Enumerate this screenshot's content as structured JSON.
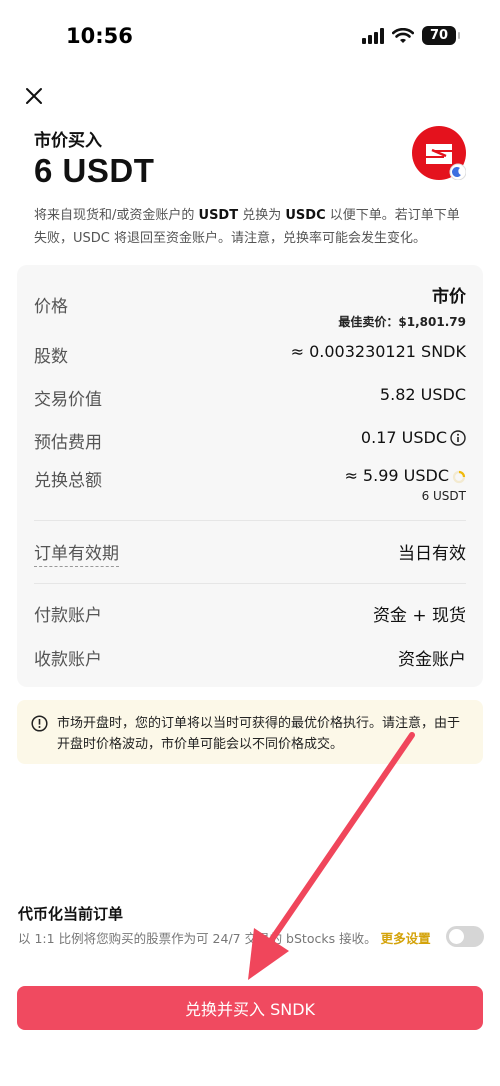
{
  "status_bar": {
    "time": "10:56",
    "battery": "70"
  },
  "header": {
    "order_type": "市价买入",
    "amount": "6 USDT",
    "description_parts": [
      "将来自现货和/或资金账户的 ",
      "USDT",
      " 兑换为 ",
      "USDC",
      " 以便下单。若订单下单失败，USDC 将退回至资金账户。请注意，兑换率可能会发生变化。"
    ]
  },
  "details": {
    "price_label": "价格",
    "price_value": "市价",
    "best_ask_label": "最佳卖价：",
    "best_ask_value": "$1,801.79",
    "shares_label": "股数",
    "shares_value": "≈ 0.003230121 SNDK",
    "trade_value_label": "交易价值",
    "trade_value": "5.82 USDC",
    "fee_label": "预估费用",
    "fee_value": "0.17 USDC",
    "total_label": "兑换总额",
    "total_value": "≈ 5.99 USDC",
    "total_sub": "6 USDT",
    "validity_label": "订单有效期",
    "validity_value": "当日有效",
    "pay_account_label": "付款账户",
    "pay_account_value": "资金 + 现货",
    "receive_account_label": "收款账户",
    "receive_account_value": "资金账户"
  },
  "notice": {
    "text": "市场开盘时，您的订单将以当时可获得的最优价格执行。请注意，由于开盘时价格波动，市价单可能会以不同价格成交。"
  },
  "tokenize": {
    "title": "代币化当前订单",
    "description": "以 1:1 比例将您购买的股票作为可 24/7 交易的 bStocks 接收。",
    "more_link": "更多设置",
    "enabled": false
  },
  "primary_button": {
    "label": "兑换并买入 SNDK"
  },
  "colors": {
    "primary": "#f04a60",
    "notice_bg": "#fcf8e8",
    "link": "#d4a30a",
    "logo_red": "#e4121d"
  },
  "icons": [
    "signal-icon",
    "wifi-icon",
    "battery-icon",
    "close-icon",
    "token-logo-icon",
    "moon-badge-icon",
    "info-icon",
    "loading-icon",
    "warning-icon",
    "annotation-arrow-icon"
  ]
}
